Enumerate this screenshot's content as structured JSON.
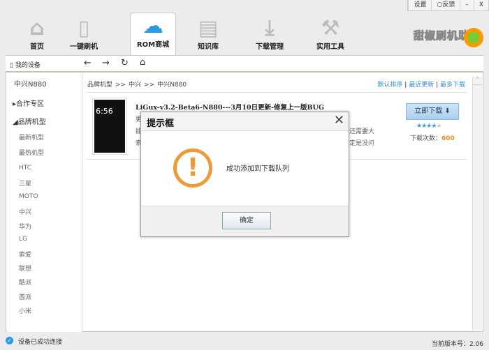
{
  "window": {
    "settings": "设置",
    "feedback": "反馈",
    "minimize": "–",
    "close": "X"
  },
  "nav": [
    {
      "label": "首页",
      "icon": "home-icon"
    },
    {
      "label": "一键刷机",
      "icon": "flash-icon"
    },
    {
      "label": "ROM商城",
      "icon": "cloud-download-icon"
    },
    {
      "label": "知识库",
      "icon": "document-icon"
    },
    {
      "label": "下载管理",
      "icon": "download-icon"
    },
    {
      "label": "实用工具",
      "icon": "tools-icon"
    }
  ],
  "brand": "甜椒刷机助手",
  "toolbar": {
    "my_device": "我的设备"
  },
  "sidebar": {
    "device": "中兴N880",
    "coop": "合作专区",
    "brands": "品牌机型",
    "items": [
      "最新机型",
      "最热机型",
      "HTC",
      "三星",
      "MOTO",
      "中兴",
      "华为",
      "LG",
      "索爱",
      "联想",
      "酷派",
      "酋派",
      "小米"
    ]
  },
  "breadcrumb": [
    "品牌机型",
    ">>",
    "中兴",
    ">>",
    "中兴N880"
  ],
  "sort": [
    "默认排序",
    "最近更新",
    "最多下载"
  ],
  "rom": {
    "title": "LiGux-v3.2-Beta6-N880---3月10日更新-修复上一版BUG",
    "line1_start": "更",
    "line2_start": "能",
    "line3_start": "索",
    "line2_end": "还需要大",
    "line3_end": "定是没问",
    "phone_time": "6:56",
    "download": "立即下载",
    "rating": 4,
    "count_label": "下载次数：",
    "count": "600"
  },
  "dialog": {
    "title": "提示框",
    "message": "成功添加到下载队列",
    "ok": "确定"
  },
  "status": {
    "connected": "设备已成功连接",
    "version": "当前版本号：2.06"
  }
}
